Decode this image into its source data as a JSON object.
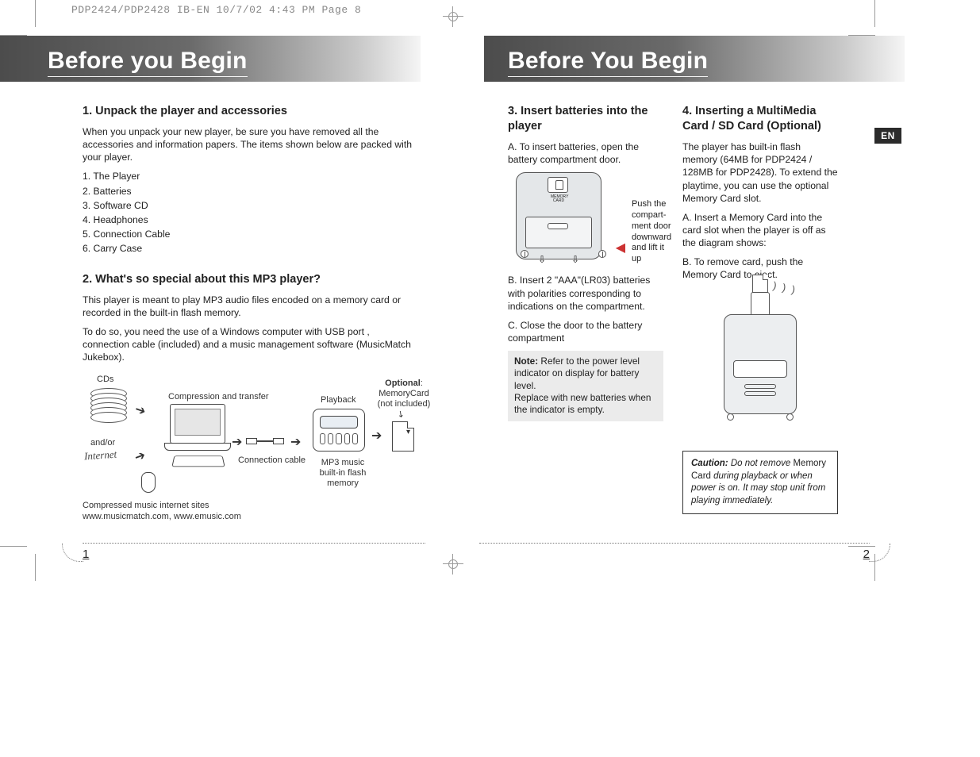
{
  "slug": "PDP2424/PDP2428 IB-EN  10/7/02  4:43 PM  Page 8",
  "lang_tab": "EN",
  "page_left_num": "1",
  "page_right_num": "2",
  "left": {
    "title": "Before you Begin",
    "s1": {
      "heading": "1.  Unpack the player and accessories",
      "intro": "When you unpack your new player, be sure you have removed all the accessories and information papers.  The items shown below are packed with your player.",
      "items": [
        "1. The Player",
        "2. Batteries",
        "3. Software CD",
        "4. Headphones",
        "5. Connection Cable",
        "6. Carry Case"
      ]
    },
    "s2": {
      "heading": "2.  What's so special about this MP3 player?",
      "p1": "This player is meant to play MP3 audio files encoded on a memory card or recorded in the built-in flash memory.",
      "p2": "To do so, you need the use of a Windows computer with USB port , connection cable (included) and a music management software (MusicMatch Jukebox).",
      "diagram": {
        "cds": "CDs",
        "andor": "and/or",
        "internet": "Internet",
        "compression": "Compression and transfer",
        "cable": "Connection cable",
        "playback": "Playback",
        "player_caption": "MP3 music built-in flash memory",
        "optional_bold": "Optional",
        "optional_rest": ": MemoryCard (not included)",
        "footnote1": "Compressed music internet sites",
        "footnote2": "www.musicmatch.com, www.emusic.com"
      }
    }
  },
  "right": {
    "title": "Before You Begin",
    "s3": {
      "heading": "3. Insert batteries into the player",
      "a": "A. To insert batteries, open the battery compartment door.",
      "push": "Push the compart-ment door downward and lift it up",
      "memcard_label": "MEMORY CARD",
      "b": "B. Insert 2 \"AAA\"(LR03) batteries with polarities corresponding to indications on the compartment.",
      "c": "C. Close the door to the battery compartment",
      "note_bold": "Note:",
      "note_rest": " Refer to the power level indicator on display for battery level.\nReplace with new batteries when the indicator is empty."
    },
    "s4": {
      "heading": "4. Inserting a MultiMedia Card / SD Card (Optional)",
      "intro": "The player has built-in flash memory (64MB for PDP2424 / 128MB for PDP2428).  To extend the playtime, you can use the optional Memory Card slot.",
      "a": "A. Insert a Memory Card into the card slot when the player is off as the diagram shows:",
      "b": "B. To remove card, push the Memory Card to eject.",
      "caution_bold": "Caution:",
      "caution_mid1": " Do not remove ",
      "caution_plain": "Memory Card",
      "caution_mid2": " during playback or when power is on. It may stop unit from playing immediately."
    }
  }
}
